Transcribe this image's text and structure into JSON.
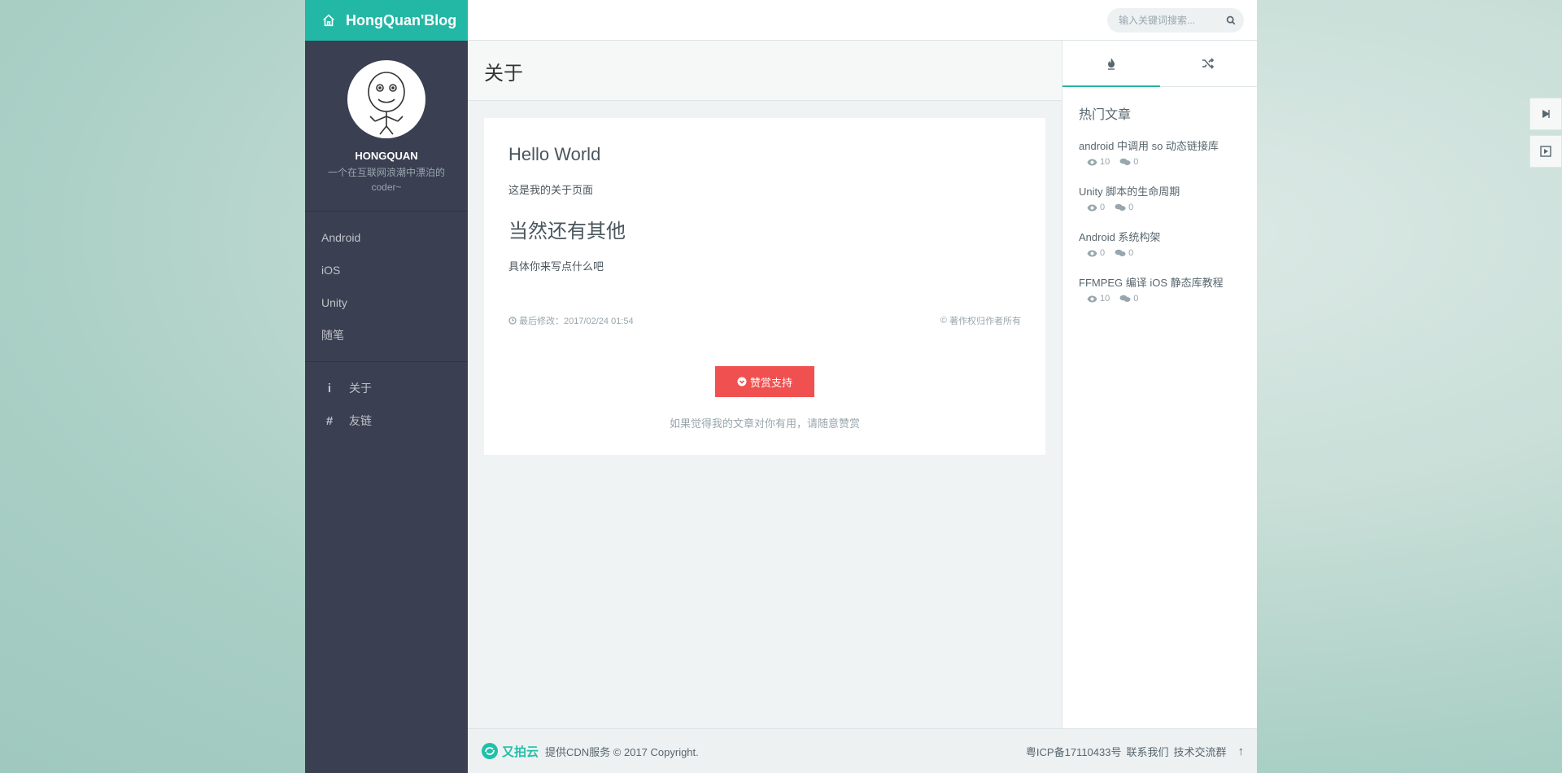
{
  "brand": {
    "title": "HongQuan'Blog"
  },
  "profile": {
    "name": "HONGQUAN",
    "motto": "一个在互联网浪潮中漂泊的coder~"
  },
  "nav": {
    "categories": [
      {
        "label": "Android"
      },
      {
        "label": "iOS"
      },
      {
        "label": "Unity"
      },
      {
        "label": "随笔"
      }
    ],
    "pages": [
      {
        "label": "关于",
        "icon": "info-icon"
      },
      {
        "label": "友链",
        "icon": "hash-icon"
      }
    ]
  },
  "search": {
    "placeholder": "输入关键词搜索..."
  },
  "page": {
    "heading": "关于"
  },
  "post": {
    "title": "Hello World",
    "paragraph1": "这是我的关于页面",
    "heading2": "当然还有其他",
    "paragraph2": "具体你来写点什么吧",
    "modified_label": "最后修改：2017/02/24 01:54",
    "copyright": "著作权归作者所有",
    "reward_button": "赞赏支持",
    "reward_note": "如果觉得我的文章对你有用，请随意赞赏"
  },
  "aside": {
    "tabs": [
      {
        "icon": "fire-icon"
      },
      {
        "icon": "shuffle-icon"
      }
    ],
    "title": "热门文章",
    "articles": [
      {
        "title": "android 中调用 so 动态链接库",
        "views": "10",
        "comments": "0"
      },
      {
        "title": "Unity 脚本的生命周期",
        "views": "0",
        "comments": "0"
      },
      {
        "title": "Android 系统构架",
        "views": "0",
        "comments": "0"
      },
      {
        "title": "FFMPEG 编译 iOS 静态库教程",
        "views": "10",
        "comments": "0"
      }
    ]
  },
  "footer": {
    "upyun": "又拍云",
    "cdn_text": "提供CDN服务 © 2017 Copyright.",
    "icp": "粤ICP备17110433号",
    "contact": "联系我们",
    "group": "技术交流群",
    "top_arrow": "↑"
  },
  "colors": {
    "accent": "#23b7a5",
    "sidebar": "#3a3f51",
    "danger": "#f05050"
  }
}
